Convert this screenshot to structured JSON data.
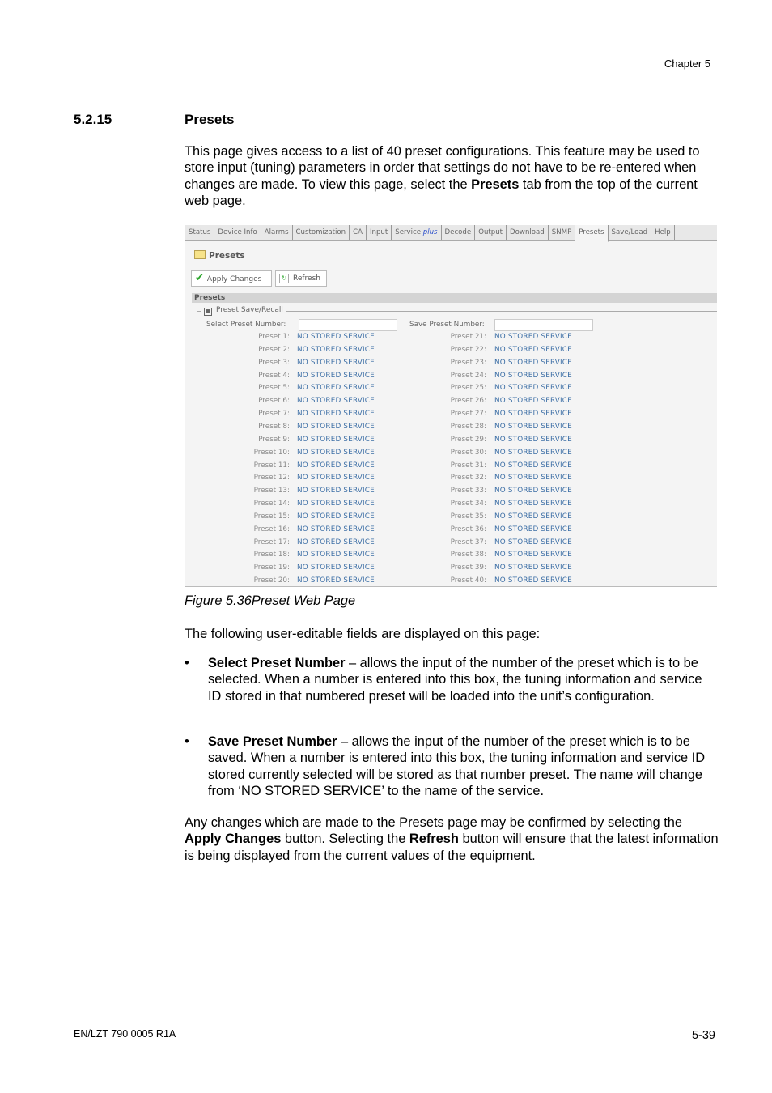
{
  "header": {
    "chapter": "Chapter 5"
  },
  "section": {
    "number": "5.2.15",
    "title": "Presets"
  },
  "intro": {
    "part1": "This page gives access to a list of 40 preset configurations. This feature may be used to store input (tuning) parameters in order that settings do not have to be re-entered when changes are made. To view this page, select the ",
    "bold": "Presets",
    "part2": " tab from the top of the current web page."
  },
  "screenshot": {
    "tabs": [
      "Status",
      "Device Info",
      "Alarms",
      "Customization",
      "CA",
      "Input",
      "Service",
      "Decode",
      "Output",
      "Download",
      "SNMP",
      "Presets",
      "Save/Load",
      "Help"
    ],
    "service_suffix": "plus",
    "active_tab": "Presets",
    "page_title": "Presets",
    "apply_label": "Apply Changes",
    "refresh_label": "Refresh",
    "section_title": "Presets",
    "fieldset_legend": "Preset Save/Recall",
    "select_label": "Select Preset Number:",
    "select_value": "",
    "save_label": "Save Preset Number:",
    "save_value": "",
    "presets": [
      {
        "label": "Preset 1:",
        "value": "NO STORED SERVICE"
      },
      {
        "label": "Preset 2:",
        "value": "NO STORED SERVICE"
      },
      {
        "label": "Preset 3:",
        "value": "NO STORED SERVICE"
      },
      {
        "label": "Preset 4:",
        "value": "NO STORED SERVICE"
      },
      {
        "label": "Preset 5:",
        "value": "NO STORED SERVICE"
      },
      {
        "label": "Preset 6:",
        "value": "NO STORED SERVICE"
      },
      {
        "label": "Preset 7:",
        "value": "NO STORED SERVICE"
      },
      {
        "label": "Preset 8:",
        "value": "NO STORED SERVICE"
      },
      {
        "label": "Preset 9:",
        "value": "NO STORED SERVICE"
      },
      {
        "label": "Preset 10:",
        "value": "NO STORED SERVICE"
      },
      {
        "label": "Preset 11:",
        "value": "NO STORED SERVICE"
      },
      {
        "label": "Preset 12:",
        "value": "NO STORED SERVICE"
      },
      {
        "label": "Preset 13:",
        "value": "NO STORED SERVICE"
      },
      {
        "label": "Preset 14:",
        "value": "NO STORED SERVICE"
      },
      {
        "label": "Preset 15:",
        "value": "NO STORED SERVICE"
      },
      {
        "label": "Preset 16:",
        "value": "NO STORED SERVICE"
      },
      {
        "label": "Preset 17:",
        "value": "NO STORED SERVICE"
      },
      {
        "label": "Preset 18:",
        "value": "NO STORED SERVICE"
      },
      {
        "label": "Preset 19:",
        "value": "NO STORED SERVICE"
      },
      {
        "label": "Preset 20:",
        "value": "NO STORED SERVICE"
      },
      {
        "label": "Preset 21:",
        "value": "NO STORED SERVICE"
      },
      {
        "label": "Preset 22:",
        "value": "NO STORED SERVICE"
      },
      {
        "label": "Preset 23:",
        "value": "NO STORED SERVICE"
      },
      {
        "label": "Preset 24:",
        "value": "NO STORED SERVICE"
      },
      {
        "label": "Preset 25:",
        "value": "NO STORED SERVICE"
      },
      {
        "label": "Preset 26:",
        "value": "NO STORED SERVICE"
      },
      {
        "label": "Preset 27:",
        "value": "NO STORED SERVICE"
      },
      {
        "label": "Preset 28:",
        "value": "NO STORED SERVICE"
      },
      {
        "label": "Preset 29:",
        "value": "NO STORED SERVICE"
      },
      {
        "label": "Preset 30:",
        "value": "NO STORED SERVICE"
      },
      {
        "label": "Preset 31:",
        "value": "NO STORED SERVICE"
      },
      {
        "label": "Preset 32:",
        "value": "NO STORED SERVICE"
      },
      {
        "label": "Preset 33:",
        "value": "NO STORED SERVICE"
      },
      {
        "label": "Preset 34:",
        "value": "NO STORED SERVICE"
      },
      {
        "label": "Preset 35:",
        "value": "NO STORED SERVICE"
      },
      {
        "label": "Preset 36:",
        "value": "NO STORED SERVICE"
      },
      {
        "label": "Preset 37:",
        "value": "NO STORED SERVICE"
      },
      {
        "label": "Preset 38:",
        "value": "NO STORED SERVICE"
      },
      {
        "label": "Preset 39:",
        "value": "NO STORED SERVICE"
      },
      {
        "label": "Preset 40:",
        "value": "NO STORED SERVICE"
      }
    ]
  },
  "caption": "Figure 5.36Preset Web Page",
  "fields_intro": "The following user-editable fields are displayed on this page:",
  "bullets": [
    {
      "bold": "Select Preset Number",
      "text": " – allows the input of the number of the preset which is to be selected. When a number is entered into this box, the tuning information and service ID stored in that numbered preset will be loaded into the unit’s configuration."
    },
    {
      "bold": "Save Preset Number",
      "text": " – allows the input of the number of the preset which is to be saved. When a number is entered into this box, the tuning information and service ID stored currently selected will be stored as that number preset. The name will change from ‘NO STORED SERVICE’ to the name of the service."
    }
  ],
  "closing": {
    "part1": "Any changes which are made to the Presets page may be confirmed by selecting the ",
    "bold1": "Apply Changes",
    "part2": " button. Selecting the ",
    "bold2": "Refresh",
    "part3": " button will ensure that the latest information is being displayed from the current values of the equipment."
  },
  "footer": {
    "doc_id": "EN/LZT 790 0005 R1A",
    "page": "5-39"
  }
}
